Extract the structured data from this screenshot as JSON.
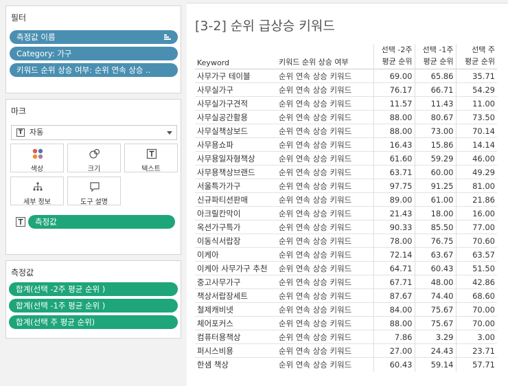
{
  "filters": {
    "title": "필터",
    "pills": [
      "측정값 이름",
      "Category: 가구",
      "키워드 순위 상승 여부: 순위 연속 상승 .."
    ]
  },
  "marks": {
    "title": "마크",
    "type": "자동",
    "buttons": [
      "색상",
      "크기",
      "텍스트",
      "세부 정보",
      "도구 설명"
    ],
    "text_pill": "측정값"
  },
  "measures": {
    "title": "측정값",
    "pills": [
      "합계(선택 -2주 평균 순위 )",
      "합계(선택 -1주 평균 순위 )",
      "합계(선택 주 평균 순위)"
    ]
  },
  "view": {
    "title": "[3-2] 순위 급상승 키워드",
    "headers": {
      "keyword": "Keyword",
      "status": "키워드 순위 상승 여부",
      "w2": [
        "선택 -2주",
        "평균 순위"
      ],
      "w1": [
        "선택 -1주",
        "평균 순위"
      ],
      "w0": [
        "선택 주",
        "평균 순위"
      ]
    },
    "rows": [
      [
        "사무가구 테이블",
        "순위 연속 상승 키워드",
        "69.00",
        "65.86",
        "35.71"
      ],
      [
        "사무실가구",
        "순위 연속 상승 키워드",
        "76.17",
        "66.71",
        "54.29"
      ],
      [
        "사무실가구견적",
        "순위 연속 상승 키워드",
        "11.57",
        "11.43",
        "11.00"
      ],
      [
        "사무실공간활용",
        "순위 연속 상승 키워드",
        "88.00",
        "80.67",
        "73.50"
      ],
      [
        "사무실책상보드",
        "순위 연속 상승 키워드",
        "88.00",
        "73.00",
        "70.14"
      ],
      [
        "사무용쇼파",
        "순위 연속 상승 키워드",
        "16.43",
        "15.86",
        "14.14"
      ],
      [
        "사무용일자형책상",
        "순위 연속 상승 키워드",
        "61.60",
        "59.29",
        "46.00"
      ],
      [
        "사무용책상브랜드",
        "순위 연속 상승 키워드",
        "63.71",
        "60.00",
        "49.29"
      ],
      [
        "서울특가가구",
        "순위 연속 상승 키워드",
        "97.75",
        "91.25",
        "81.00"
      ],
      [
        "신규파티션판매",
        "순위 연속 상승 키워드",
        "89.00",
        "61.00",
        "21.86"
      ],
      [
        "아크릴칸막이",
        "순위 연속 상승 키워드",
        "21.43",
        "18.00",
        "16.00"
      ],
      [
        "옥션가구특가",
        "순위 연속 상승 키워드",
        "90.33",
        "85.50",
        "77.00"
      ],
      [
        "이동식서랍장",
        "순위 연속 상승 키워드",
        "78.00",
        "76.75",
        "70.60"
      ],
      [
        "이케아",
        "순위 연속 상승 키워드",
        "72.14",
        "63.67",
        "63.57"
      ],
      [
        "이케아 사무가구 추천",
        "순위 연속 상승 키워드",
        "64.71",
        "60.43",
        "51.50"
      ],
      [
        "중고사무가구",
        "순위 연속 상승 키워드",
        "67.71",
        "48.00",
        "42.86"
      ],
      [
        "책상서랍장세트",
        "순위 연속 상승 키워드",
        "87.67",
        "74.40",
        "68.60"
      ],
      [
        "철제캐비넷",
        "순위 연속 상승 키워드",
        "84.00",
        "75.67",
        "70.00"
      ],
      [
        "체어포커스",
        "순위 연속 상승 키워드",
        "88.00",
        "75.67",
        "70.00"
      ],
      [
        "컴퓨터용책상",
        "순위 연속 상승 키워드",
        "7.86",
        "3.29",
        "3.00"
      ],
      [
        "퍼시스비용",
        "순위 연속 상승 키워드",
        "27.00",
        "24.43",
        "23.71"
      ],
      [
        "한샘 책상",
        "순위 연속 상승 키워드",
        "60.43",
        "59.14",
        "57.71"
      ]
    ]
  },
  "colors": {
    "filter_pill": "#4a8fb1",
    "measure_pill": "#1ea57a"
  }
}
